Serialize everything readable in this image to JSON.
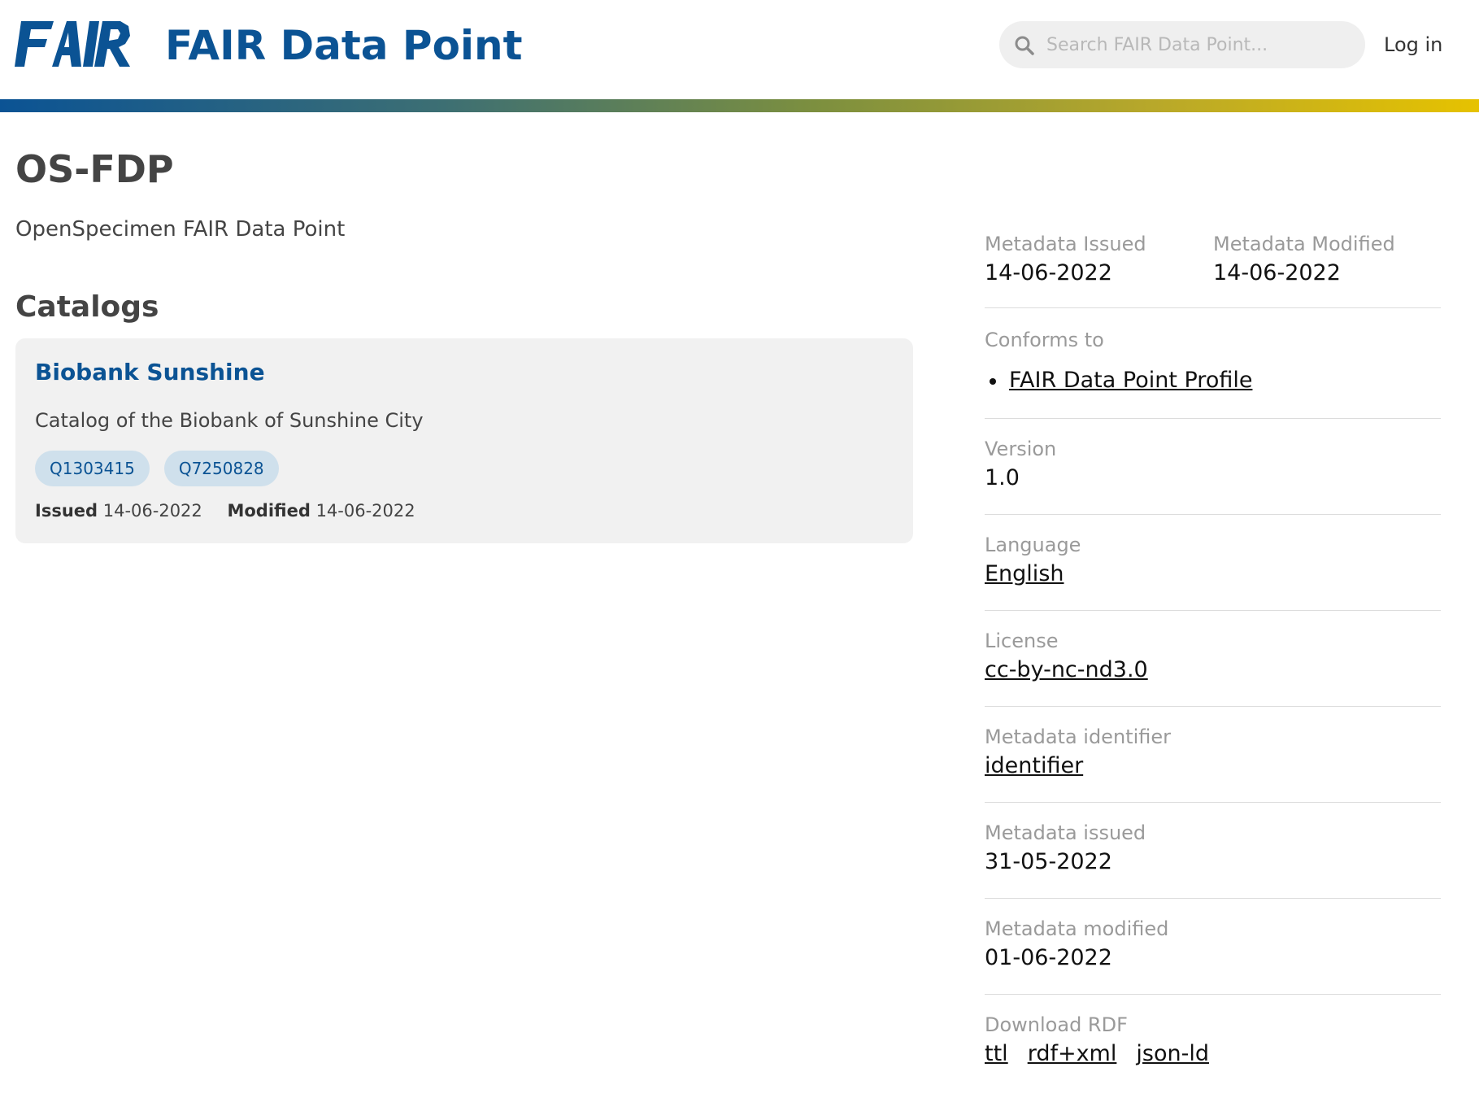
{
  "header": {
    "title": "FAIR Data Point",
    "logo_text": "FAIR",
    "search_placeholder": "Search FAIR Data Point...",
    "login_label": "Log in"
  },
  "colors": {
    "brand": "#0b5394",
    "tag_bg": "#cfe0ec",
    "card_bg": "#f1f1f1",
    "gradient_start": "#0b5394",
    "gradient_end": "#e6c200"
  },
  "main": {
    "title": "OS-FDP",
    "description": "OpenSpecimen FAIR Data Point",
    "catalogs_heading": "Catalogs",
    "catalogs": [
      {
        "title": "Biobank Sunshine",
        "description": "Catalog of the Biobank of Sunshine City",
        "tags": [
          "Q1303415",
          "Q7250828"
        ],
        "issued_label": "Issued",
        "issued": "14-06-2022",
        "modified_label": "Modified",
        "modified": "14-06-2022"
      }
    ]
  },
  "sidebar": {
    "metadata_issued_label": "Metadata Issued",
    "metadata_issued": "14-06-2022",
    "metadata_modified_label": "Metadata Modified",
    "metadata_modified": "14-06-2022",
    "conforms_to_label": "Conforms to",
    "conforms_to": "FAIR Data Point Profile",
    "version_label": "Version",
    "version": "1.0",
    "language_label": "Language",
    "language": "English",
    "license_label": "License",
    "license": "cc-by-nc-nd3.0",
    "identifier_label": "Metadata identifier",
    "identifier": "identifier",
    "issued_label": "Metadata issued",
    "issued": "31-05-2022",
    "modified_label": "Metadata modified",
    "modified": "01-06-2022",
    "download_label": "Download RDF",
    "download_formats": [
      "ttl",
      "rdf+xml",
      "json-ld"
    ]
  }
}
